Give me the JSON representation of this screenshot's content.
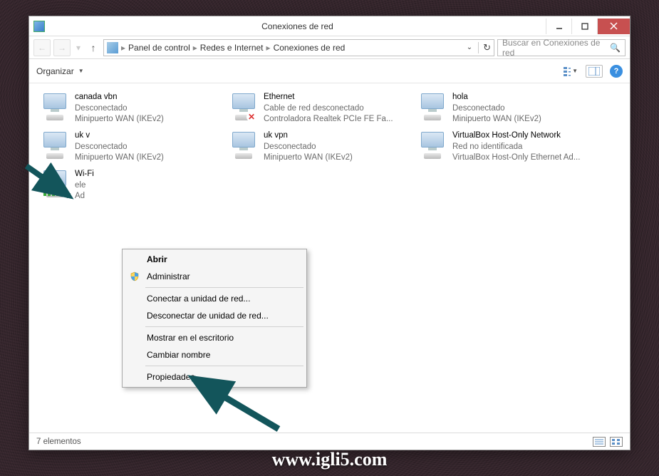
{
  "window": {
    "title": "Conexiones de red"
  },
  "breadcrumb": {
    "segments": [
      "Panel de control",
      "Redes e Internet",
      "Conexiones de red"
    ]
  },
  "search": {
    "placeholder": "Buscar en Conexiones de red"
  },
  "commandbar": {
    "organize": "Organizar"
  },
  "items": [
    {
      "name": "canada vbn",
      "status": "Desconectado",
      "adapter": "Minipuerto WAN (IKEv2)",
      "x": false,
      "wifi": false
    },
    {
      "name": "Ethernet",
      "status": "Cable de red desconectado",
      "adapter": "Controladora Realtek PCIe FE Fa...",
      "x": true,
      "wifi": false
    },
    {
      "name": "hola",
      "status": "Desconectado",
      "adapter": "Minipuerto WAN (IKEv2)",
      "x": false,
      "wifi": false
    },
    {
      "name": "uk v",
      "status": "Desconectado",
      "adapter": "Minipuerto WAN (IKEv2)",
      "x": false,
      "wifi": false
    },
    {
      "name": "uk vpn",
      "status": "Desconectado",
      "adapter": "Minipuerto WAN (IKEv2)",
      "x": false,
      "wifi": false
    },
    {
      "name": "VirtualBox Host-Only Network",
      "status": "Red no identificada",
      "adapter": "VirtualBox Host-Only Ethernet Ad...",
      "x": false,
      "wifi": false
    },
    {
      "name": "Wi-Fi",
      "status": "ele",
      "adapter": "Ad",
      "x": false,
      "wifi": true
    }
  ],
  "contextmenu": {
    "open": "Abrir",
    "admin": "Administrar",
    "connect": "Conectar a unidad de red...",
    "disconnect": "Desconectar de unidad de red...",
    "desktop": "Mostrar en el escritorio",
    "rename": "Cambiar nombre",
    "properties": "Propiedades"
  },
  "statusbar": {
    "count": "7 elementos"
  },
  "watermark": "www.igli5.com"
}
